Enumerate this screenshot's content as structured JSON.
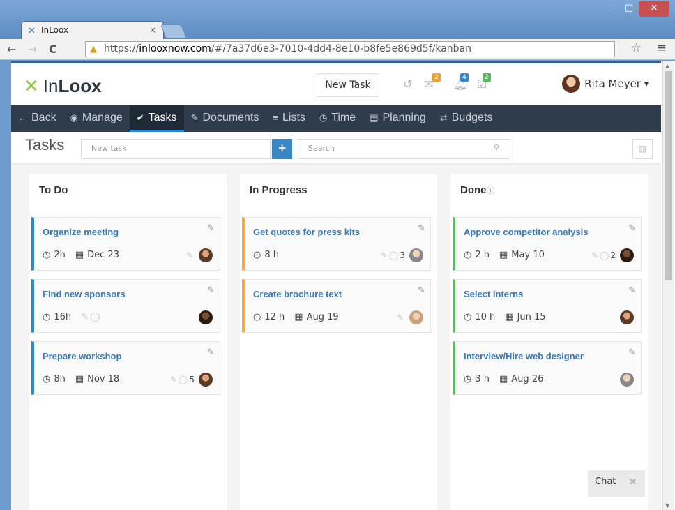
{
  "browser": {
    "tab_title": "InLoox",
    "tab_close": "×",
    "url_prefix": "https://",
    "url_host": "inlooxnow.com",
    "url_rest": "/#/7a37d6e3-7010-4dd4-8e10-b8fe5e869d5f/kanban",
    "win_minimize": "–",
    "win_maximize": "□",
    "win_close": "×"
  },
  "header": {
    "logo_prefix": "In",
    "logo_bold": "Loox",
    "new_task_label": "New Task",
    "badges": {
      "messages": "2",
      "notifications": "4",
      "tasks": "2"
    },
    "user_name": "Rita Meyer",
    "user_caret": "▾"
  },
  "nav": {
    "items": [
      {
        "icon": "←",
        "label": "Back"
      },
      {
        "icon": "◉",
        "label": "Manage"
      },
      {
        "icon": "✔",
        "label": "Tasks"
      },
      {
        "icon": "✎",
        "label": "Documents"
      },
      {
        "icon": "≡",
        "label": "Lists"
      },
      {
        "icon": "◷",
        "label": "Time"
      },
      {
        "icon": "▤",
        "label": "Planning"
      },
      {
        "icon": "⇄",
        "label": "Budgets"
      }
    ]
  },
  "taskbar": {
    "title": "Tasks",
    "new_task_placeholder": "New task",
    "add_label": "+",
    "search_placeholder": "Search"
  },
  "columns": [
    {
      "title": "To Do",
      "cards": [
        {
          "title": "Organize meeting",
          "hours": "2h",
          "date": "Dec 23",
          "comments": ""
        },
        {
          "title": "Find new sponsors",
          "hours": "16h",
          "date": "",
          "comments": ""
        },
        {
          "title": "Prepare workshop",
          "hours": "8h",
          "date": "Nov 18",
          "comments": "5"
        }
      ]
    },
    {
      "title": "In Progress",
      "cards": [
        {
          "title": "Get quotes for press kits",
          "hours": "8 h",
          "date": "",
          "comments": "3"
        },
        {
          "title": "Create brochure text",
          "hours": "12 h",
          "date": "Aug 19",
          "comments": ""
        }
      ]
    },
    {
      "title": "Done",
      "cards": [
        {
          "title": "Approve competitor analysis",
          "hours": "2 h",
          "date": "May 10",
          "comments": "2"
        },
        {
          "title": "Select interns",
          "hours": "10 h",
          "date": "Jun 15",
          "comments": ""
        },
        {
          "title": "Interview/Hire web designer",
          "hours": "3 h",
          "date": "Aug 26",
          "comments": ""
        }
      ]
    }
  ],
  "chat": {
    "label": "Chat"
  },
  "colors": {
    "nav_bg": "#2e3c4b",
    "accent_blue": "#2b87d6",
    "orange": "#f4a64c",
    "green": "#5cb85c",
    "badge_orange": "#f0a02c",
    "badge_blue": "#3a87c8",
    "badge_green": "#5cb85c"
  }
}
